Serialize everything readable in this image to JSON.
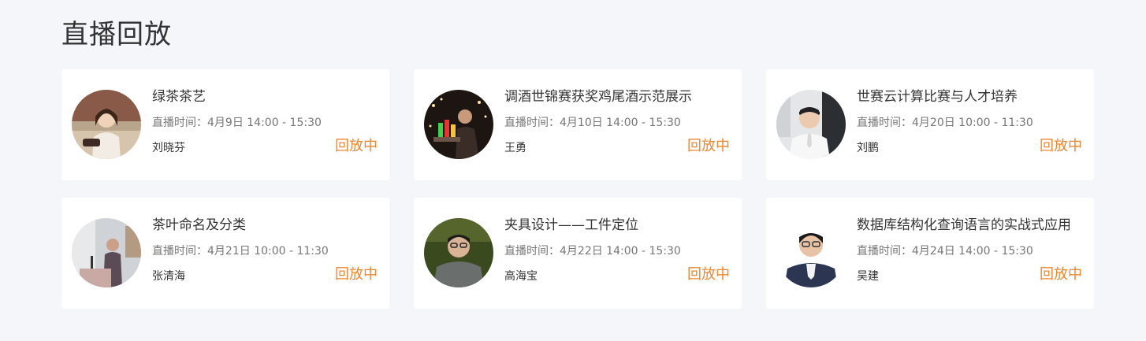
{
  "section": {
    "title": "直播回放"
  },
  "cards": [
    {
      "title": "绿茶茶艺",
      "time_prefix": "直播时间：",
      "time": "4月9日 14:00 - 15:30",
      "host": "刘晓芬",
      "status": "回放中"
    },
    {
      "title": "调酒世锦赛获奖鸡尾酒示范展示",
      "time_prefix": "直播时间：",
      "time": "4月10日 14:00 - 15:30",
      "host": "王勇",
      "status": "回放中"
    },
    {
      "title": "世赛云计算比赛与人才培养",
      "time_prefix": "直播时间：",
      "time": "4月20日 10:00 - 11:30",
      "host": "刘鹏",
      "status": "回放中"
    },
    {
      "title": "茶叶命名及分类",
      "time_prefix": "直播时间：",
      "time": "4月21日 10:00 - 11:30",
      "host": "张清海",
      "status": "回放中"
    },
    {
      "title": "夹具设计——工件定位",
      "time_prefix": "直播时间：",
      "time": "4月22日 14:00 - 15:30",
      "host": "高海宝",
      "status": "回放中"
    },
    {
      "title": "数据库结构化查询语言的实战式应用",
      "time_prefix": "直播时间：",
      "time": "4月24日 14:00 - 15:30",
      "host": "吴建",
      "status": "回放中"
    }
  ],
  "colors": {
    "page_bg": "#f5f6fa",
    "card_bg": "#ffffff",
    "title_text": "#333333",
    "meta_text": "#777777",
    "status_accent": "#f0862e"
  }
}
